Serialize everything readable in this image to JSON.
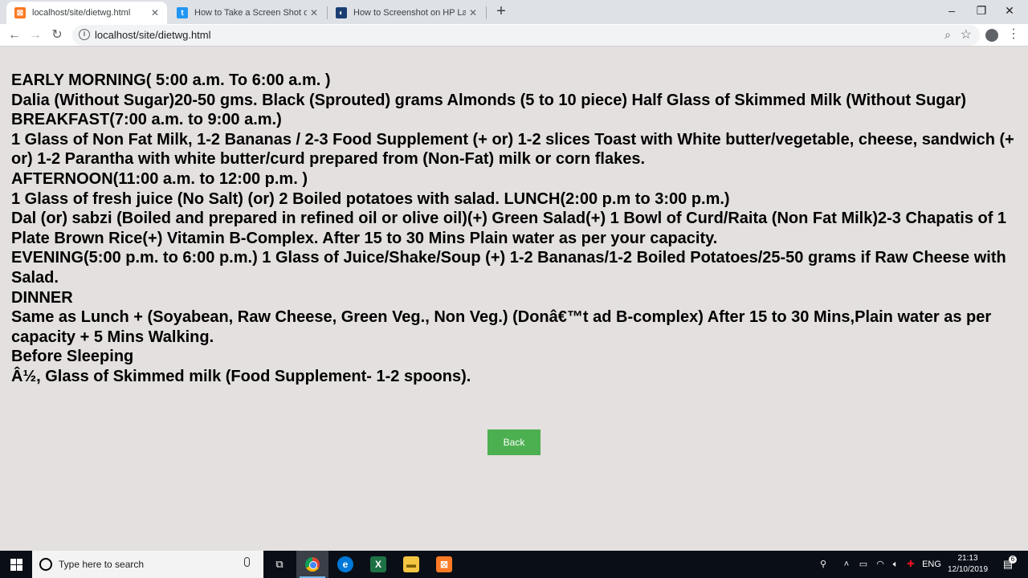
{
  "browser": {
    "tabs": [
      {
        "title": "localhost/site/dietwg.html",
        "active": true,
        "favicon": "xampp-icon",
        "color": "#fb7a24"
      },
      {
        "title": "How to Take a Screen Shot on a Windows PC",
        "active": false,
        "favicon": "tumblr-icon",
        "color": "#2196f3"
      },
      {
        "title": "How to Screenshot on HP Laptop or Desktop Computers",
        "active": false,
        "favicon": "hp-icon",
        "color": "#1a3e72"
      }
    ],
    "new_tab_symbol": "+",
    "window_controls": {
      "minimize": "–",
      "maximize": "❐",
      "close": "✕"
    },
    "address": "localhost/site/dietwg.html",
    "nav": {
      "back": "←",
      "forward": "→",
      "reload": "↻"
    }
  },
  "page": {
    "lines": [
      "EARLY MORNING( 5:00 a.m. To 6:00 a.m. )",
      "Dalia (Without Sugar)20-50 gms. Black (Sprouted) grams Almonds (5 to 10 piece) Half Glass of Skimmed Milk (Without Sugar)",
      "BREAKFAST(7:00 a.m. to 9:00 a.m.)",
      "1 Glass of Non Fat Milk, 1-2 Bananas / 2-3 Food Supplement (+ or) 1-2 slices Toast with White butter/vegetable, cheese, sandwich (+ or) 1-2 Parantha with white butter/curd prepared from (Non-Fat) milk or corn flakes.",
      "AFTERNOON(11:00 a.m. to 12:00 p.m. )",
      "1 Glass of fresh juice (No Salt) (or) 2 Boiled potatoes with salad. LUNCH(2:00 p.m to 3:00 p.m.)",
      "Dal (or) sabzi (Boiled and prepared in refined oil or olive oil)(+) Green Salad(+) 1 Bowl of Curd/Raita (Non Fat Milk)2-3 Chapatis of 1 Plate Brown Rice(+) Vitamin B-Complex. After 15 to 30 Mins Plain water as per your capacity.",
      "EVENING(5:00 p.m. to 6:00 p.m.) 1 Glass of Juice/Shake/Soup (+) 1-2 Bananas/1-2 Boiled Potatoes/25-50 grams if Raw Cheese with Salad.",
      "DINNER",
      "Same as Lunch + (Soyabean, Raw Cheese, Green Veg., Non Veg.) (Donâ€™t ad B-complex) After 15 to 30 Mins,Plain water as per capacity + 5 Mins Walking.",
      "Before Sleeping",
      "Â½, Glass of Skimmed milk (Food Supplement- 1-2 spoons)."
    ],
    "back_button": "Back",
    "button_color": "#4caf50"
  },
  "taskbar": {
    "search_placeholder": "Type here to search",
    "language": "ENG",
    "time": "21:13",
    "date": "12/10/2019",
    "notification_count": "6"
  }
}
